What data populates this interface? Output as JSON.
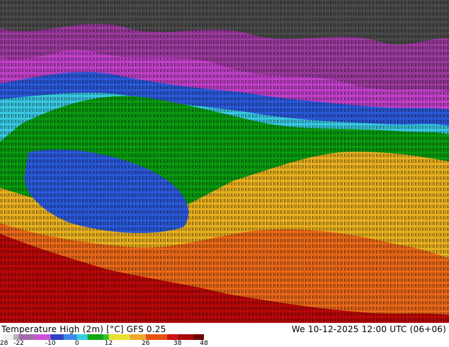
{
  "title": "Temperature High (2m) [°C] GFS 0.25",
  "timestamp": "We 10-12-2025 12:00 UTC (06+06)",
  "legend": {
    "ticks": [
      "-28",
      "-22",
      "-10",
      "0",
      "12",
      "26",
      "38",
      "48"
    ],
    "stops": [
      {
        "value": -28,
        "color": "#f0f0f0"
      },
      {
        "value": -24,
        "color": "#b4b4b4"
      },
      {
        "value": -22,
        "color": "#a06aa8"
      },
      {
        "value": -16,
        "color": "#d050d8"
      },
      {
        "value": -10,
        "color": "#3040c8"
      },
      {
        "value": -5,
        "color": "#3c88e8"
      },
      {
        "value": 0,
        "color": "#30d0e0"
      },
      {
        "value": 4,
        "color": "#10a810"
      },
      {
        "value": 10,
        "color": "#30c030"
      },
      {
        "value": 12,
        "color": "#e8e030"
      },
      {
        "value": 20,
        "color": "#f0a828"
      },
      {
        "value": 26,
        "color": "#e85010"
      },
      {
        "value": 34,
        "color": "#d01010"
      },
      {
        "value": 38,
        "color": "#a80808"
      },
      {
        "value": 44,
        "color": "#700000"
      },
      {
        "value": 48,
        "color": "#3a0000"
      }
    ]
  },
  "colors": {
    "arctic": "#4a4a4a",
    "subarctic": "#9a3a9c",
    "cold": "#c040c8",
    "freezing": "#2a58d8",
    "near_zero": "#38c8e0",
    "mild": "#0a9a10",
    "warm": "#e8b020",
    "hot": "#e86818",
    "very_hot": "#b80808"
  }
}
